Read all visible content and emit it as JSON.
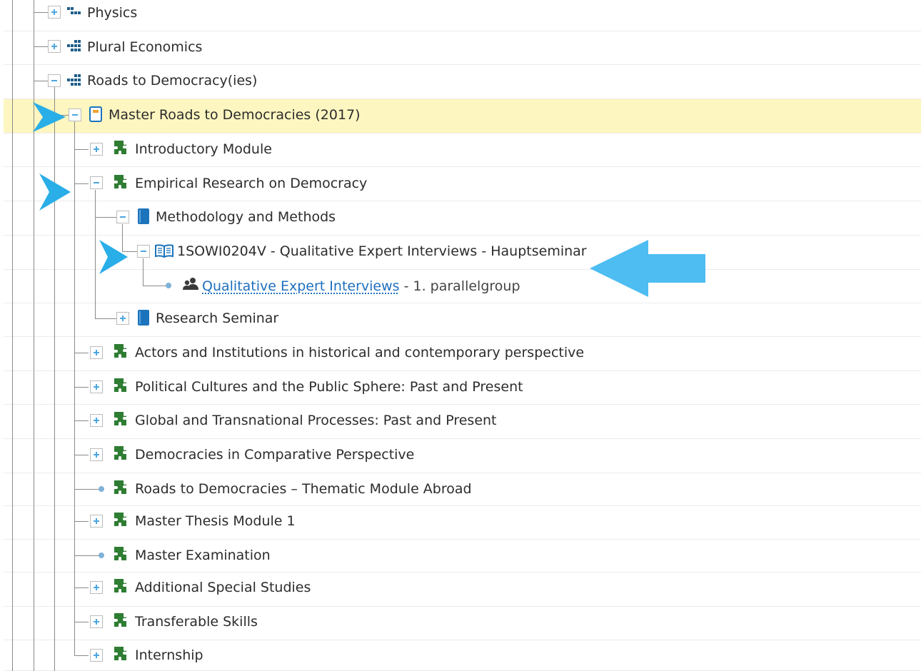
{
  "tree": {
    "nodes": {
      "physics": {
        "label": "Physics",
        "icon": "org-unit-icon",
        "state": "collapsed"
      },
      "plural_economics": {
        "label": "Plural Economics",
        "icon": "org-unit-icon",
        "state": "collapsed"
      },
      "roads_to_democracies": {
        "label": "Roads to Democracy(ies)",
        "icon": "org-unit-icon",
        "state": "expanded"
      },
      "master_roads": {
        "label": "Master Roads to Democracies (2017)",
        "icon": "study-program-icon",
        "state": "expanded",
        "highlighted": true
      },
      "introductory_module": {
        "label": "Introductory Module",
        "icon": "module-puzzle-icon",
        "state": "collapsed"
      },
      "empirical_research": {
        "label": "Empirical Research on Democracy",
        "icon": "module-puzzle-icon",
        "state": "expanded"
      },
      "methodology": {
        "label": "Methodology and Methods",
        "icon": "submodule-book-icon",
        "state": "expanded"
      },
      "course_1sowi": {
        "label": "1SOWI0204V - Qualitative Expert Interviews - Hauptseminar",
        "icon": "course-open-book-icon",
        "state": "expanded"
      },
      "parallelgroup": {
        "label": "Qualitative Expert Interviews",
        "suffix": " - 1. parallelgroup",
        "icon": "group-people-icon",
        "state": "leaf"
      },
      "research_seminar": {
        "label": "Research Seminar",
        "icon": "submodule-book-icon",
        "state": "collapsed"
      },
      "actors_institutions": {
        "label": "Actors and Institutions in historical and contemporary perspective",
        "icon": "module-puzzle-icon",
        "state": "collapsed"
      },
      "political_cultures": {
        "label": "Political Cultures and the Public Sphere: Past and Present",
        "icon": "module-puzzle-icon",
        "state": "collapsed"
      },
      "global_transnational": {
        "label": "Global and Transnational Processes: Past and Present",
        "icon": "module-puzzle-icon",
        "state": "collapsed"
      },
      "democracies_comparative": {
        "label": "Democracies in Comparative Perspective",
        "icon": "module-puzzle-icon",
        "state": "collapsed"
      },
      "thematic_abroad": {
        "label": "Roads to Democracies – Thematic Module Abroad",
        "icon": "module-puzzle-icon",
        "state": "leaf"
      },
      "master_thesis": {
        "label": "Master Thesis Module 1",
        "icon": "module-puzzle-icon",
        "state": "collapsed"
      },
      "master_examination": {
        "label": "Master Examination",
        "icon": "module-puzzle-icon",
        "state": "leaf"
      },
      "additional_special": {
        "label": "Additional Special Studies",
        "icon": "module-puzzle-icon",
        "state": "collapsed"
      },
      "transferable_skills": {
        "label": "Transferable Skills",
        "icon": "module-puzzle-icon",
        "state": "collapsed"
      },
      "internship": {
        "label": "Internship",
        "icon": "module-puzzle-icon",
        "state": "collapsed"
      }
    }
  },
  "annotations": {
    "pointer_color": "#29aee8",
    "arrow_color": "#4dbdf2",
    "items": [
      "arrowhead-pointer-icon",
      "block-arrow-icon"
    ]
  },
  "colors": {
    "highlight": "#fdf6c0",
    "tree_line": "#8a8a8a",
    "toggle_accent": "#4da6e0",
    "module_green": "#2e7d32",
    "book_blue": "#1c74bc",
    "program_orange": "#f0a030",
    "link_blue": "#1f6fbf"
  }
}
